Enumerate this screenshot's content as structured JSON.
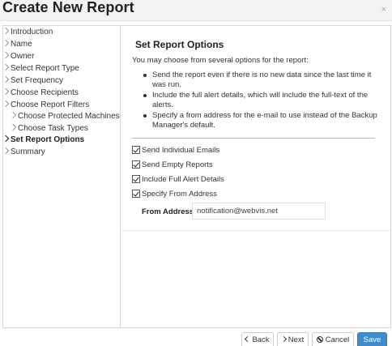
{
  "window": {
    "title": "Create New Report",
    "close_glyph": "×"
  },
  "sidebar": {
    "items": [
      {
        "label": "Introduction",
        "active": false,
        "indent": false
      },
      {
        "label": "Name",
        "active": false,
        "indent": false
      },
      {
        "label": "Owner",
        "active": false,
        "indent": false
      },
      {
        "label": "Select Report Type",
        "active": false,
        "indent": false
      },
      {
        "label": "Set Frequency",
        "active": false,
        "indent": false
      },
      {
        "label": "Choose Recipients",
        "active": false,
        "indent": false
      },
      {
        "label": "Choose Report Filters",
        "active": false,
        "indent": false
      },
      {
        "label": "Choose Protected Machines",
        "active": false,
        "indent": true
      },
      {
        "label": "Choose Task Types",
        "active": false,
        "indent": true
      },
      {
        "label": "Set Report Options",
        "active": true,
        "indent": false
      },
      {
        "label": "Summary",
        "active": false,
        "indent": false
      }
    ]
  },
  "main": {
    "title": "Set Report Options",
    "intro": "You may choose from several options for the report:",
    "bullets": [
      "Send the report even if there is no new data since the last time it was run.",
      "Include the full alert details, which will include the full-text of the alerts.",
      "Specify a from address for the e-mail to use instead of the Backup Manager's default."
    ],
    "options": [
      {
        "label": "Send Individual Emails",
        "checked": true
      },
      {
        "label": "Send Empty Reports",
        "checked": true
      },
      {
        "label": "Include Full Alert Details",
        "checked": true
      },
      {
        "label": "Specify From Address",
        "checked": true
      }
    ],
    "from_address": {
      "label": "From Address",
      "value": "notification@webvis.net"
    }
  },
  "footer": {
    "back_label": "Back",
    "next_label": "Next",
    "cancel_label": "Cancel",
    "save_label": "Save"
  },
  "colors": {
    "primary": "#428bca",
    "border": "#d6d6d6"
  }
}
